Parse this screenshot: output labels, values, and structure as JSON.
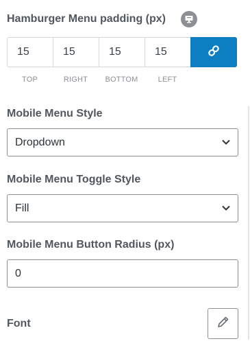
{
  "hamburger_padding": {
    "label": "Hamburger Menu padding (px)",
    "responsive_icon": "desktop-monitor-icon",
    "values": {
      "top": "15",
      "right": "15",
      "bottom": "15",
      "left": "15"
    },
    "side_labels": {
      "top": "TOP",
      "right": "RIGHT",
      "bottom": "BOTTOM",
      "left": "LEFT"
    },
    "link_icon": "link-icon",
    "linked": true
  },
  "mobile_menu_style": {
    "label": "Mobile Menu Style",
    "selected": "Dropdown"
  },
  "mobile_menu_toggle_style": {
    "label": "Mobile Menu Toggle Style",
    "selected": "Fill"
  },
  "mobile_menu_button_radius": {
    "label": "Mobile Menu Button Radius (px)",
    "value": "0"
  },
  "font": {
    "label": "Font",
    "edit_icon": "pencil-icon"
  },
  "colors": {
    "accent": "#0b7fc1",
    "label_text": "#50575e",
    "muted": "#8c8f94"
  }
}
